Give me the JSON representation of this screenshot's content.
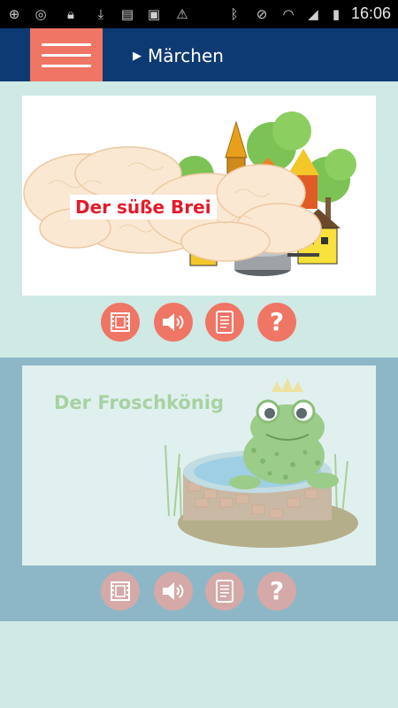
{
  "status_bar": {
    "time": "16:06"
  },
  "header": {
    "title": "Märchen",
    "accent_color": "#ef7565",
    "bar_color": "#0e3a73"
  },
  "stories": [
    {
      "title": "Der süße Brei",
      "active": true,
      "actions": [
        "video-icon",
        "speaker-icon",
        "ebook-icon",
        "question-icon"
      ]
    },
    {
      "title": "Der Froschkönig",
      "active": false,
      "actions": [
        "video-icon",
        "speaker-icon",
        "ebook-icon",
        "question-icon"
      ]
    }
  ],
  "question_glyph": "?"
}
